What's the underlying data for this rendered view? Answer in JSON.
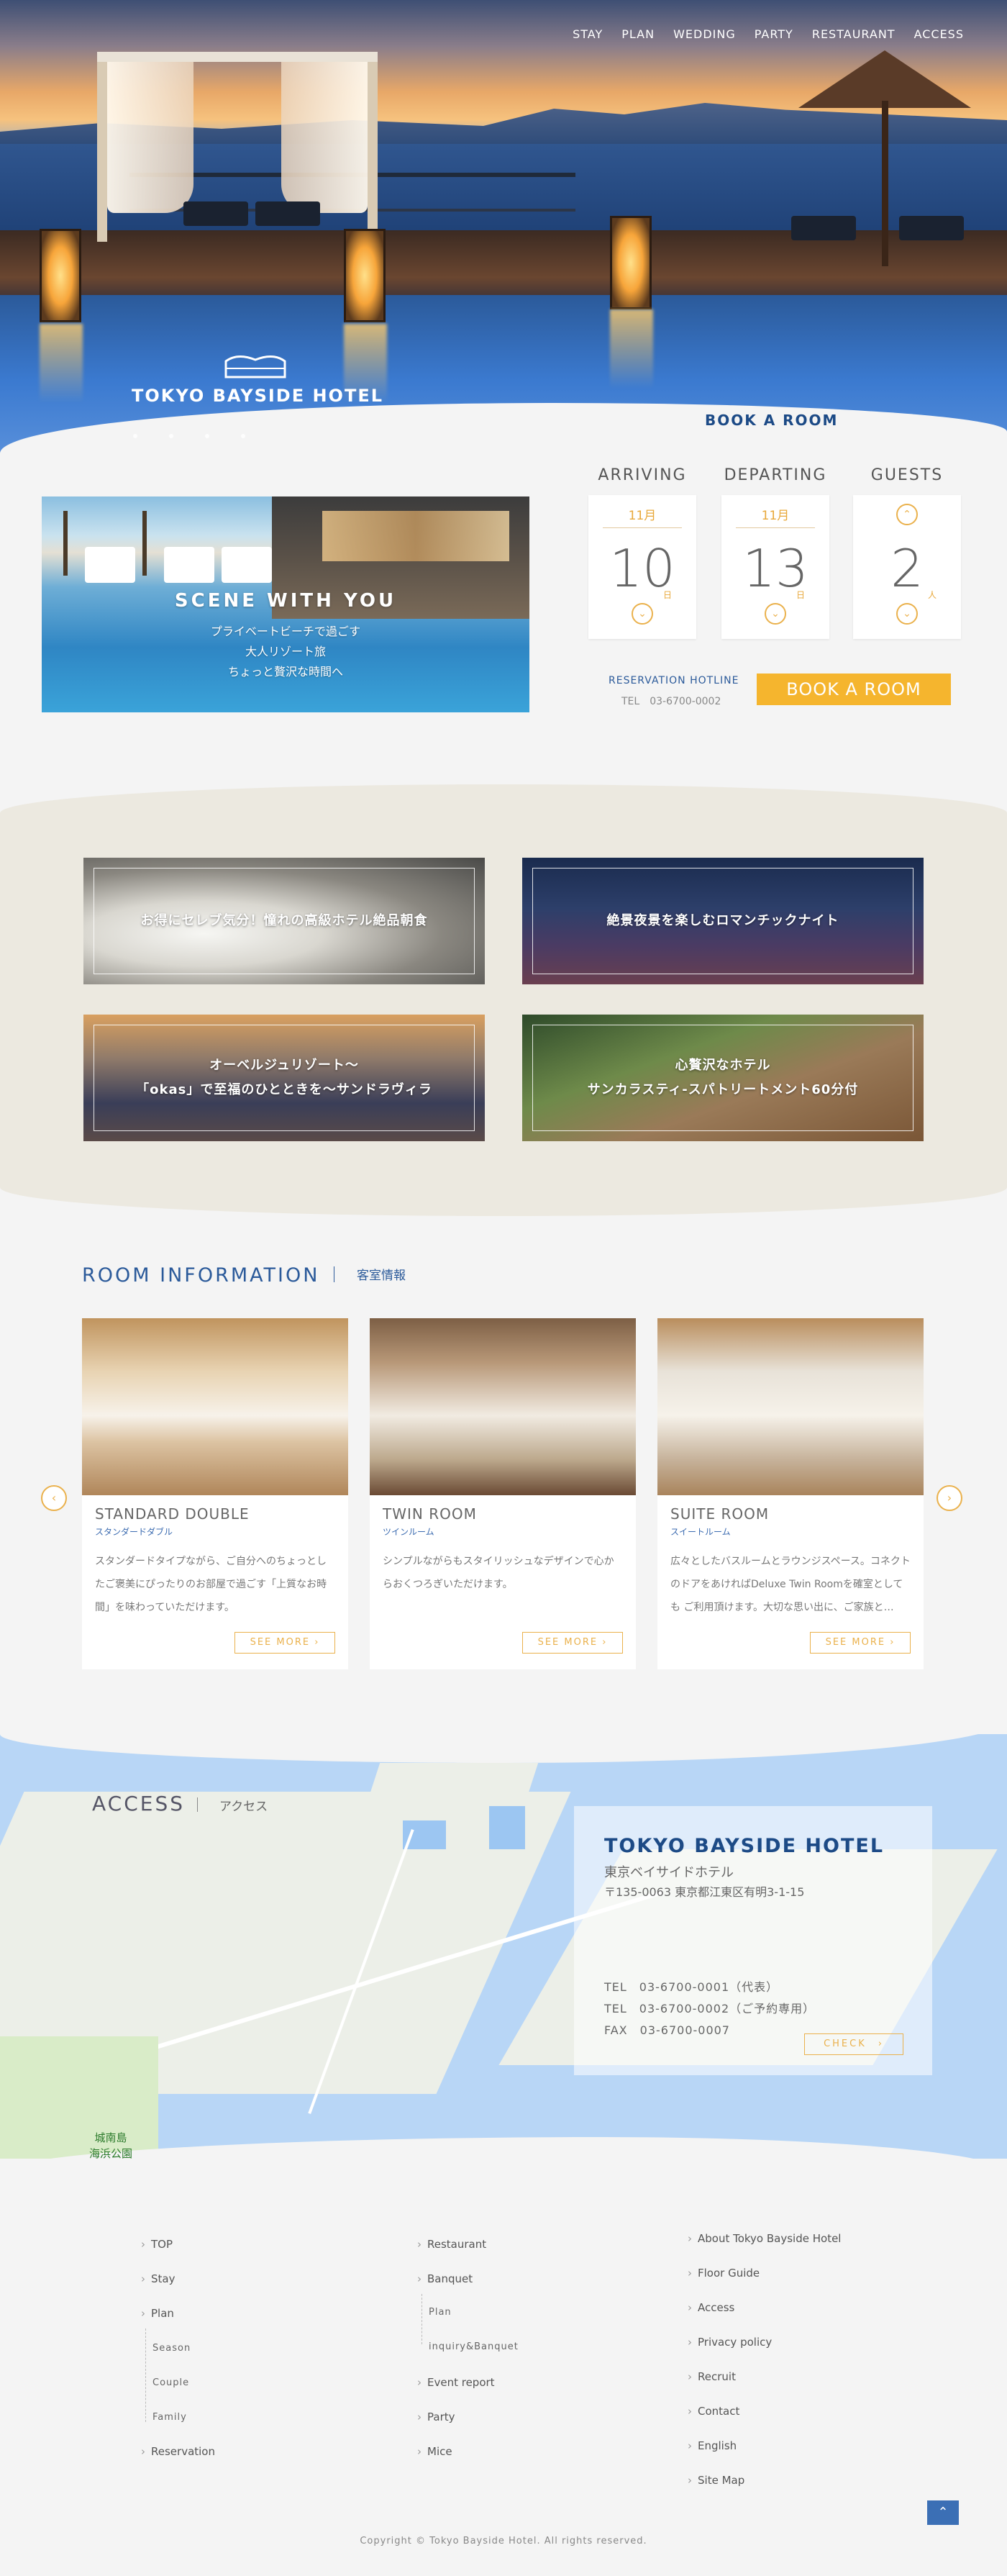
{
  "nav": [
    "STAY",
    "PLAN",
    "WEDDING",
    "PARTY",
    "RESTAURANT",
    "ACCESS"
  ],
  "hero": {
    "logo_text": "TOKYO BAYSIDE HOTEL",
    "book_link": "BOOK A ROOM",
    "slide_count": 4
  },
  "scene": {
    "title": "SCENE WITH YOU",
    "lines": [
      "プライベートビーチで過ごす",
      "大人リゾート旅",
      "ちょっと贅沢な時間へ"
    ]
  },
  "booking": {
    "arriving": {
      "label": "ARRIVING",
      "month": "11月",
      "day": "10",
      "unit": "日"
    },
    "departing": {
      "label": "DEPARTING",
      "month": "11月",
      "day": "13",
      "unit": "日"
    },
    "guests": {
      "label": "GUESTS",
      "count": "2",
      "unit": "人"
    },
    "hotline_label": "RESERVATION HOTLINE",
    "hotline_number": "TEL　03-6700-0002",
    "button": "BOOK A ROOM"
  },
  "promos": [
    {
      "lines": [
        "お得にセレブ気分！憧れの高級ホテル絶品朝食"
      ]
    },
    {
      "lines": [
        "絶景夜景を楽しむロマンチックナイト"
      ]
    },
    {
      "lines": [
        "オーベルジュリゾート～",
        "「okas」で至福のひとときを～サンドラヴィラ"
      ]
    },
    {
      "lines": [
        "心贅沢なホテル",
        "サンカラスティ-スパトリートメント60分付"
      ]
    }
  ],
  "rooms_section": {
    "title": "ROOM INFORMATION",
    "subtitle": "客室情報"
  },
  "rooms": [
    {
      "name": "STANDARD DOUBLE",
      "jp": "スタンダードダブル",
      "desc": "スタンダードタイプながら、ご自分へのちょっとしたご褒美にぴったりのお部屋で過ごす「上質なお時間」を味わっていただけます。",
      "more": "SEE MORE ›"
    },
    {
      "name": "TWIN ROOM",
      "jp": "ツインルーム",
      "desc": "シンプルながらもスタイリッシュなデザインで心からおくつろぎいただけます。",
      "more": "SEE MORE ›"
    },
    {
      "name": "SUITE ROOM",
      "jp": "スイートルーム",
      "desc": "広々としたバスルームとラウンジスペース。コネクトのドアをあければDeluxe Twin Roomを確室としても ご利用頂けます。大切な思い出に、ご家族と…",
      "more": "SEE MORE ›"
    }
  ],
  "access": {
    "title": "ACCESS",
    "subtitle": "アクセス",
    "hotel_name": "TOKYO BAYSIDE HOTEL",
    "hotel_jp": "東京ベイサイドホテル",
    "address": "〒135-0063 東京都江東区有明3-1-15",
    "tel1": "TEL　03-6700-0001（代表）",
    "tel2": "TEL　03-6700-0002（ご予約専用）",
    "fax": "FAX　03-6700-0007",
    "check": "CHECK　›",
    "park_lines": [
      "城南島",
      "海浜公園"
    ]
  },
  "footer": {
    "col1": [
      "TOP",
      "Stay",
      "Plan",
      "Reservation"
    ],
    "col1_sub": [
      "Season",
      "Couple",
      "Family"
    ],
    "col2": [
      "Restaurant",
      "Banquet",
      "Event report",
      "Party",
      "Mice"
    ],
    "col2_sub": [
      "Plan",
      "inquiry&Banquet"
    ],
    "col3": [
      "About Tokyo Bayside  Hotel",
      "Floor Guide",
      "Access",
      "Privacy policy",
      "Recruit",
      "Contact",
      "English",
      "Site Map"
    ],
    "copyright": "Copyright © Tokyo Bayside Hotel. All rights reserved."
  },
  "colors": {
    "accent": "#f5b52e",
    "brand_blue": "#1c4a86",
    "link_blue": "#2b5a9a"
  }
}
